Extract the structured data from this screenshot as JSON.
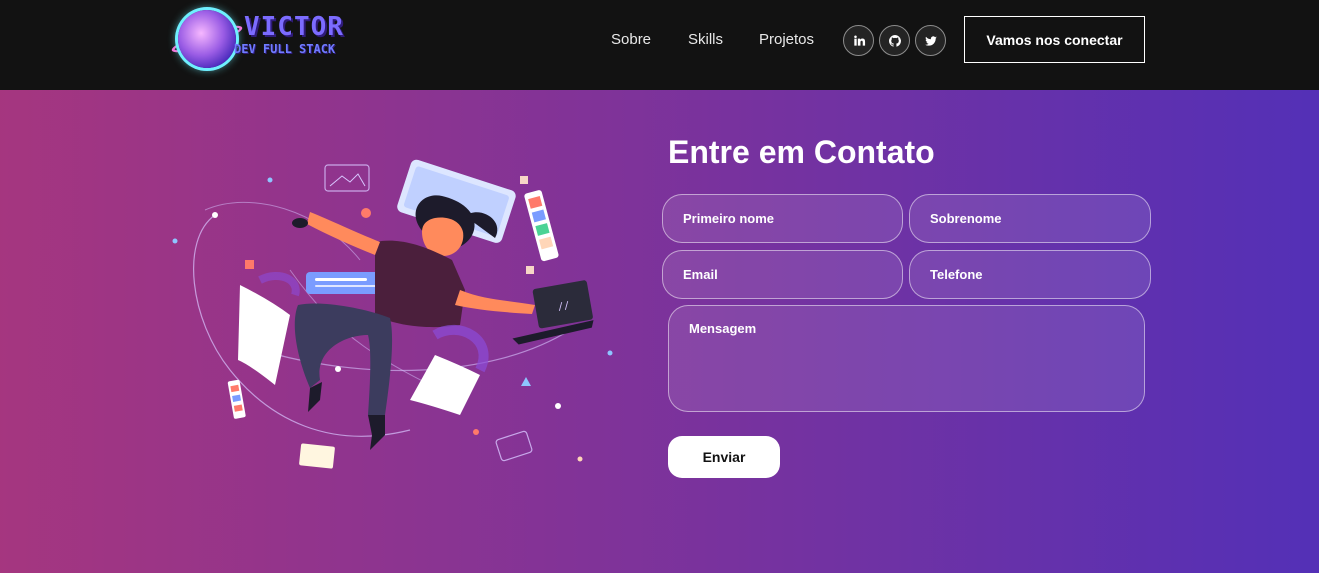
{
  "brand": {
    "title": "VICTOR",
    "subtitle": "DEV FULL STACK"
  },
  "nav": {
    "links": [
      "Sobre",
      "Skills",
      "Projetos"
    ],
    "social": [
      "linkedin-icon",
      "github-icon",
      "twitter-icon"
    ],
    "cta_label": "Vamos nos conectar"
  },
  "contact": {
    "title": "Entre em Contato",
    "fields": {
      "first_name": "Primeiro nome",
      "last_name": "Sobrenome",
      "email": "Email",
      "phone": "Telefone",
      "message": "Mensagem"
    },
    "submit_label": "Enviar"
  },
  "colors": {
    "navbar": "#121212",
    "gradient_start": "#aa367c",
    "gradient_end": "#4a2fbd",
    "button_bg": "#ffffff"
  }
}
